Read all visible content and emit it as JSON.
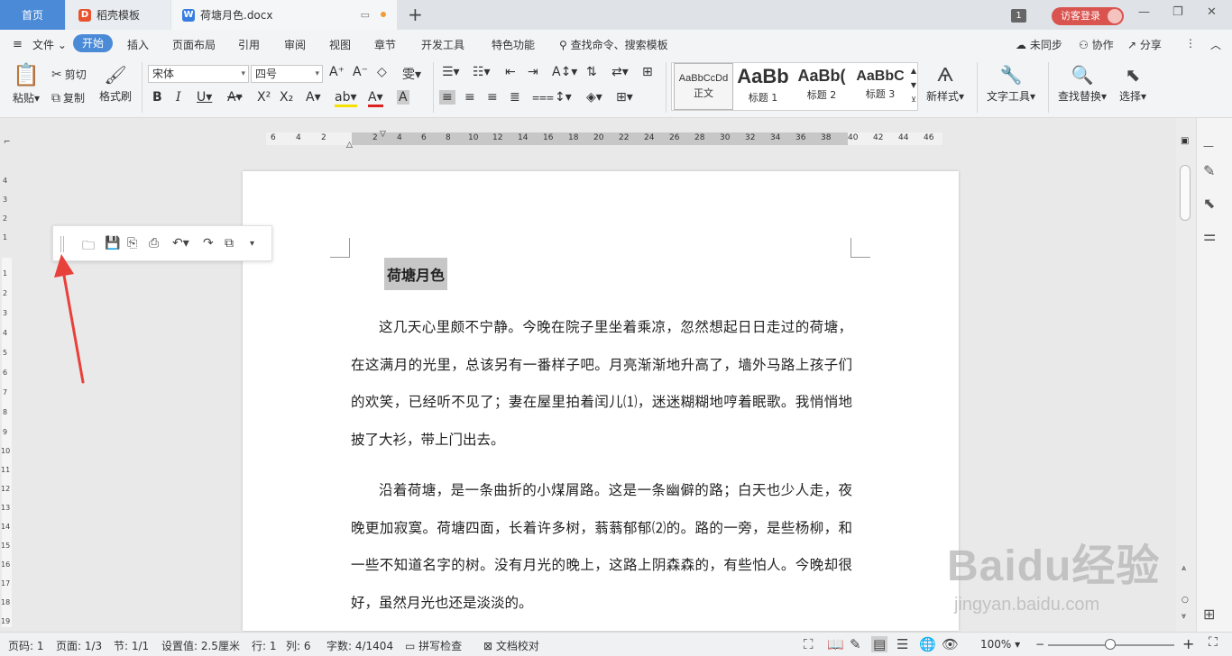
{
  "titlebar": {
    "tabs": [
      {
        "label": "首页"
      },
      {
        "label": "稻壳模板"
      },
      {
        "label": "荷塘月色.docx"
      }
    ],
    "window_badge": "1",
    "login_label": "访客登录"
  },
  "menubar": {
    "file_label": "文件",
    "items": [
      "开始",
      "插入",
      "页面布局",
      "引用",
      "审阅",
      "视图",
      "章节",
      "开发工具",
      "特色功能"
    ],
    "search_placeholder": "查找命令、搜索模板",
    "right": {
      "sync": "未同步",
      "collab": "协作",
      "share": "分享"
    }
  },
  "ribbon": {
    "paste": "粘贴",
    "cut": "剪切",
    "copy": "复制",
    "format_painter": "格式刷",
    "font_name": "宋体",
    "font_size": "四号",
    "styles": [
      {
        "sample": "AaBbCcDd",
        "name": "正文"
      },
      {
        "sample": "AaBb",
        "name": "标题 1"
      },
      {
        "sample": "AaBb(",
        "name": "标题 2"
      },
      {
        "sample": "AaBbC",
        "name": "标题 3"
      }
    ],
    "new_style": "新样式",
    "text_tools": "文字工具",
    "find_replace": "查找替换",
    "select": "选择"
  },
  "ruler": {
    "numbers": [
      "6",
      "4",
      "2",
      "2",
      "4",
      "6",
      "8",
      "10",
      "12",
      "14",
      "16",
      "18",
      "20",
      "22",
      "24",
      "26",
      "28",
      "30",
      "32",
      "34",
      "36",
      "38",
      "40",
      "42",
      "44",
      "46"
    ]
  },
  "vruler": {
    "numbers": [
      "4",
      "3",
      "2",
      "1",
      "1",
      "2",
      "3",
      "4",
      "5",
      "6",
      "7",
      "8",
      "9",
      "10",
      "11",
      "12",
      "13",
      "14",
      "15",
      "16",
      "17",
      "18",
      "19"
    ]
  },
  "document": {
    "title": "荷塘月色",
    "paragraphs": [
      "这几天心里颇不宁静。今晚在院子里坐着乘凉，忽然想起日日走过的荷塘，在这满月的光里，总该另有一番样子吧。月亮渐渐地升高了，墙外马路上孩子们的欢笑，已经听不见了；妻在屋里拍着闰儿⑴，迷迷糊糊地哼着眠歌。我悄悄地披了大衫，带上门出去。",
      "沿着荷塘，是一条曲折的小煤屑路。这是一条幽僻的路；白天也少人走，夜晚更加寂寞。荷塘四面，长着许多树，蓊蓊郁郁⑵的。路的一旁，是些杨柳，和一些不知道名字的树。没有月光的晚上，这路上阴森森的，有些怕人。今晚却很好，虽然月光也还是淡淡的。"
    ]
  },
  "statusbar": {
    "page_code": "页码: 1",
    "page": "页面: 1/3",
    "section": "节: 1/1",
    "setting": "设置值: 2.5厘米",
    "row": "行: 1",
    "col": "列: 6",
    "words": "字数: 4/1404",
    "spell": "拼写检查",
    "proof": "文档校对",
    "zoom": "100%"
  },
  "watermark": {
    "brand": "Baidu经验",
    "url": "jingyan.baidu.com"
  },
  "colors": {
    "accent": "#4a8ad7",
    "login": "#d9534f",
    "arrow": "#e8403a",
    "highlight": "#c7c7c7"
  }
}
